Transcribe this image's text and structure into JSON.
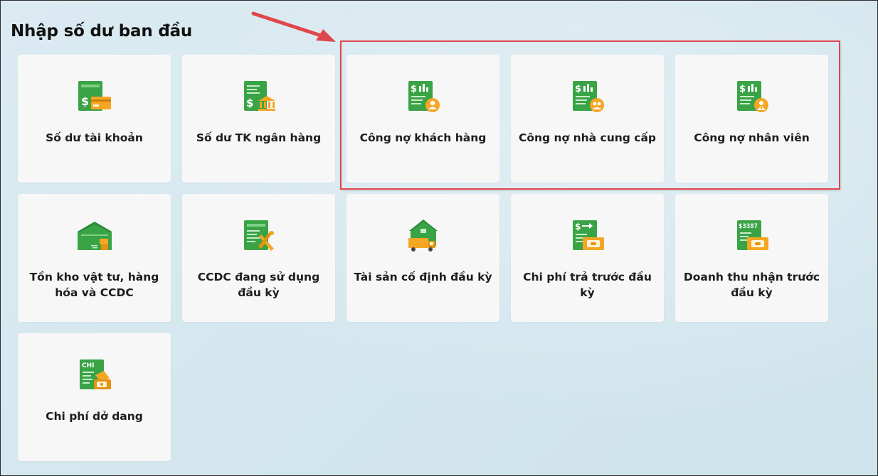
{
  "page": {
    "title": "Nhập số dư ban đầu"
  },
  "tiles": [
    {
      "label": "Số dư tài khoản"
    },
    {
      "label": "Số dư TK ngân hàng"
    },
    {
      "label": "Công nợ khách hàng"
    },
    {
      "label": "Công nợ nhà cung cấp"
    },
    {
      "label": "Công nợ nhân viên"
    },
    {
      "label": "Tồn kho vật tư, hàng hóa và CCDC"
    },
    {
      "label": "CCDC đang sử dụng đầu kỳ"
    },
    {
      "label": "Tài sản cố định đầu kỳ"
    },
    {
      "label": "Chi phí trả trước đầu kỳ"
    },
    {
      "label": "Doanh thu nhận trước đầu kỳ"
    },
    {
      "label": "Chi phí dở dang"
    }
  ],
  "icon_texts": {
    "chi": "CHI",
    "doc_code": "$3387"
  },
  "colors": {
    "icon_green": "#3aa346",
    "icon_green_dark": "#2b8a37",
    "icon_orange": "#f5a623",
    "highlight": "#e0474c"
  }
}
